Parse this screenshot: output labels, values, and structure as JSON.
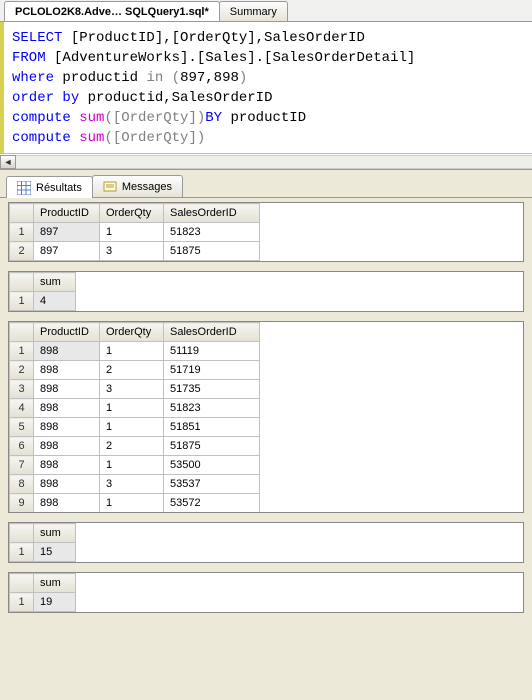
{
  "tabs": {
    "file": "PCLOLO2K8.Adve… SQLQuery1.sql*",
    "summary": "Summary"
  },
  "sql": {
    "l1a": "SELECT",
    "l1b": " [ProductID],[OrderQty],SalesOrderID",
    "l2a": "FROM",
    "l2b": " [AdventureWorks].[Sales].[SalesOrderDetail]",
    "l3a": "where",
    "l3b": " productid ",
    "l3c": "in",
    "l3d": " (",
    "l3e": "897,898",
    "l3f": ")",
    "l4a": "order",
    "l4b": " ",
    "l4c": "by",
    "l4d": " productid,SalesOrderID",
    "l5a": "compute",
    "l5b": " ",
    "l5c": "sum",
    "l5d": "([OrderQty])",
    "l5e": "BY",
    "l5f": " productID",
    "l6a": "compute",
    "l6b": " ",
    "l6c": "sum",
    "l6d": "([OrderQty])"
  },
  "resultTabs": {
    "results": "Résultats",
    "messages": "Messages"
  },
  "cols": {
    "product": "ProductID",
    "qty": "OrderQty",
    "order": "SalesOrderID",
    "sum": "sum"
  },
  "grid1": [
    {
      "n": "1",
      "p": "897",
      "q": "1",
      "o": "51823"
    },
    {
      "n": "2",
      "p": "897",
      "q": "3",
      "o": "51875"
    }
  ],
  "sum1": {
    "n": "1",
    "v": "4"
  },
  "grid2": [
    {
      "n": "1",
      "p": "898",
      "q": "1",
      "o": "51119"
    },
    {
      "n": "2",
      "p": "898",
      "q": "2",
      "o": "51719"
    },
    {
      "n": "3",
      "p": "898",
      "q": "3",
      "o": "51735"
    },
    {
      "n": "4",
      "p": "898",
      "q": "1",
      "o": "51823"
    },
    {
      "n": "5",
      "p": "898",
      "q": "1",
      "o": "51851"
    },
    {
      "n": "6",
      "p": "898",
      "q": "2",
      "o": "51875"
    },
    {
      "n": "7",
      "p": "898",
      "q": "1",
      "o": "53500"
    },
    {
      "n": "8",
      "p": "898",
      "q": "3",
      "o": "53537"
    },
    {
      "n": "9",
      "p": "898",
      "q": "1",
      "o": "53572"
    }
  ],
  "sum2": {
    "n": "1",
    "v": "15"
  },
  "sum3": {
    "n": "1",
    "v": "19"
  }
}
